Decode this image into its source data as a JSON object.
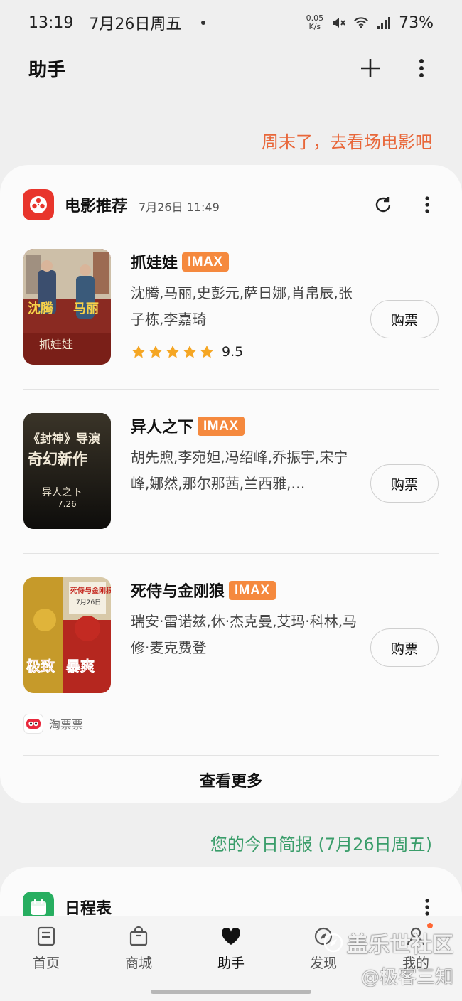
{
  "status_bar": {
    "time": "13:19",
    "date": "7月26日周五",
    "net_speed_value": "0.05",
    "net_speed_unit": "K/s",
    "battery": "73%"
  },
  "app_bar": {
    "title": "助手",
    "add_icon": "plus-icon",
    "more_icon": "more-vertical-icon"
  },
  "promo_text": "周末了，去看场电影吧",
  "movie_card": {
    "title": "电影推荐",
    "timestamp": "7月26日 11:49",
    "refresh_icon": "refresh-icon",
    "movies": [
      {
        "title": "抓娃娃",
        "badge": "IMAX",
        "cast": "沈腾,马丽,史彭元,萨日娜,肖帛辰,张子栋,李嘉琦",
        "rating": 9.5,
        "rating_text": "9.5",
        "stars": 5,
        "buy_label": "购票",
        "poster_text": [
          "沈腾",
          "马丽",
          "抓娃娃"
        ]
      },
      {
        "title": "异人之下",
        "badge": "IMAX",
        "cast": "胡先煦,李宛妲,冯绍峰,乔振宇,宋宁峰,娜然,那尔那茜,兰西雅,…",
        "buy_label": "购票",
        "poster_text": [
          "《封神》导演",
          "奇幻新作",
          "异人之下",
          "7.26"
        ]
      },
      {
        "title": "死侍与金刚狼",
        "badge": "IMAX",
        "cast": "瑞安·雷诺兹,休·杰克曼,艾玛·科林,马修·麦克费登",
        "buy_label": "购票",
        "poster_text": [
          "死侍与金刚狼",
          "7月26日",
          "极致",
          "暴爽"
        ]
      }
    ],
    "source": "淘票票",
    "more_label": "查看更多"
  },
  "brief_text": "您的今日简报 (7月26日周五)",
  "schedule_card": {
    "title": "日程表"
  },
  "bottom_nav": [
    {
      "label": "首页",
      "icon": "home-icon"
    },
    {
      "label": "商城",
      "icon": "shopping-bag-icon"
    },
    {
      "label": "助手",
      "icon": "heart-icon",
      "active": true
    },
    {
      "label": "发现",
      "icon": "compass-icon"
    },
    {
      "label": "我的",
      "icon": "profile-icon"
    }
  ],
  "watermark": {
    "line1": "盖乐世社区",
    "line2": "@极客三知"
  },
  "colors": {
    "promo": "#e8673a",
    "brief": "#3a9d6a",
    "imax_badge": "#f5893e",
    "star": "#f5a623",
    "app_logo": "#e8352c",
    "calendar_logo": "#27ae60"
  }
}
